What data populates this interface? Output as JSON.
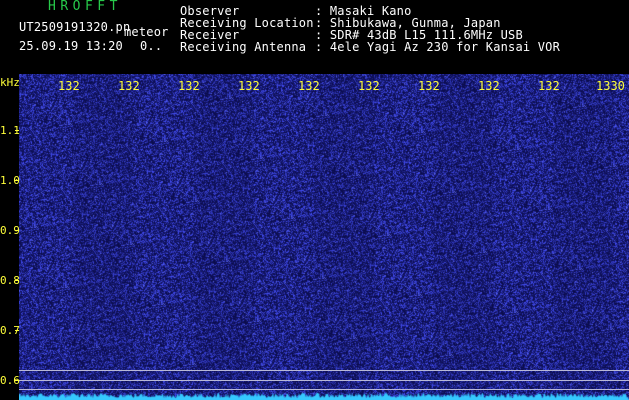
{
  "header": {
    "app_title": "HROFFT",
    "file_name": "UT2509191320.pn",
    "meteor_tag": "meteor",
    "date_time": "25.09.19 13:20",
    "count": "0..",
    "info": [
      {
        "label": "Observer",
        "value": ": Masaki Kano"
      },
      {
        "label": "Receiving Location",
        "value": ": Shibukawa, Gunma, Japan"
      },
      {
        "label": "Receiver",
        "value": ": SDR# 43dB L15 111.6MHz USB"
      },
      {
        "label": "Receiving Antenna",
        "value": ": 4ele Yagi Az 230 for Kansai VOR"
      }
    ]
  },
  "spectrogram": {
    "y_unit": "kHz",
    "y_ticks": [
      "1.1",
      "1.0",
      "0.9",
      "0.8",
      "0.7",
      "0.6"
    ],
    "time_labels": [
      "132",
      "132",
      "132",
      "132",
      "132",
      "132",
      "132",
      "132",
      "132",
      "1330"
    ],
    "colors": {
      "background": "#0a0b4a",
      "noise": "#3c46d2",
      "baseline": "#35c8ff",
      "label": "#ffff3a"
    }
  }
}
